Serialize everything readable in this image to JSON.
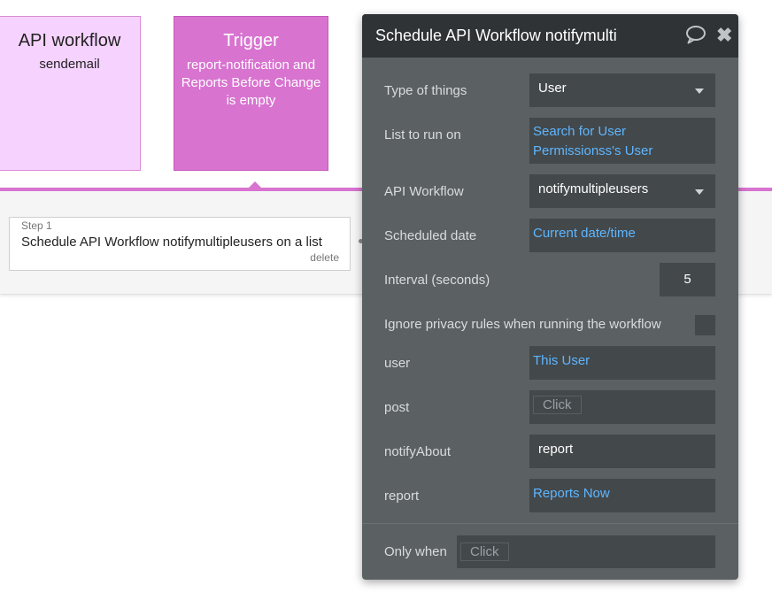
{
  "cards": {
    "api": {
      "title": "API workflow",
      "subtitle": "sendemail"
    },
    "trigger": {
      "title": "Trigger",
      "subtitle": "report-notification and Reports Before Change is empty"
    }
  },
  "step": {
    "label": "Step 1",
    "text": "Schedule API Workflow notifymultipleusers on a list",
    "delete_label": "delete"
  },
  "panel": {
    "title": "Schedule API Workflow notifymultipleusers on a list",
    "colors": {
      "header": "#2f3336",
      "body": "#5b6063",
      "field": "#43484b",
      "link": "#5eb6ff"
    },
    "rows": {
      "type_of_things": {
        "label": "Type of things",
        "value": "User"
      },
      "list_to_run_on": {
        "label": "List to run on",
        "value": "Search for User Permissionss's User"
      },
      "api_workflow": {
        "label": "API Workflow",
        "value": "notifymultipleusers"
      },
      "scheduled_date": {
        "label": "Scheduled date",
        "value": "Current date/time"
      },
      "interval": {
        "label": "Interval (seconds)",
        "value": "5"
      },
      "ignore_privacy": {
        "label": "Ignore privacy rules when running the workflow"
      },
      "user": {
        "label": "user",
        "value": "This User"
      },
      "post": {
        "label": "post",
        "placeholder": "Click"
      },
      "notify_about": {
        "label": "notifyAbout",
        "value": "report"
      },
      "report": {
        "label": "report",
        "value": "Reports Now"
      }
    },
    "only_when": {
      "label": "Only when",
      "placeholder": "Click"
    }
  }
}
